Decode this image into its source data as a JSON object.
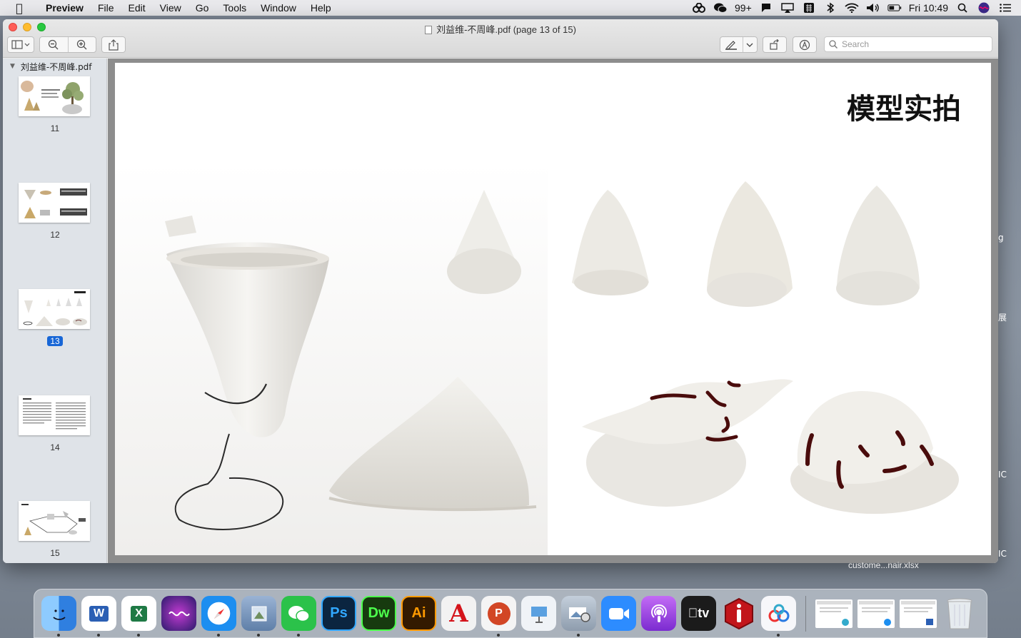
{
  "menubar": {
    "app_name": "Preview",
    "menus": [
      "File",
      "Edit",
      "View",
      "Go",
      "Tools",
      "Window",
      "Help"
    ],
    "wechat_badge": "99+",
    "clock": "Fri 10:49"
  },
  "window": {
    "title": "刘益维-不周峰.pdf (page 13 of 15)",
    "search_placeholder": "Search"
  },
  "sidebar": {
    "file_name": "刘益维-不周峰.pdf",
    "pages": [
      {
        "num": "11"
      },
      {
        "num": "12"
      },
      {
        "num": "13",
        "selected": true
      },
      {
        "num": "14"
      },
      {
        "num": "15"
      }
    ]
  },
  "page": {
    "title": "模型实拍"
  },
  "desktop": {
    "file_label": "custome...nair.xlsx",
    "edge_labels": [
      "g",
      "展",
      "IC",
      "IC"
    ]
  },
  "dock": {
    "apps": [
      {
        "name": "Finder",
        "label": "",
        "color": "#2f8ff0"
      },
      {
        "name": "Word",
        "label": "W",
        "color": "#2b5fb4"
      },
      {
        "name": "Excel",
        "label": "X",
        "color": "#1f7a45"
      },
      {
        "name": "Siri",
        "label": "",
        "color": "#5b3bb5"
      },
      {
        "name": "Safari",
        "label": "",
        "color": "#1c8ef0"
      },
      {
        "name": "Preview",
        "label": "",
        "color": "#6f8fb8"
      },
      {
        "name": "WeChat",
        "label": "",
        "color": "#2bc24a"
      },
      {
        "name": "Photoshop",
        "label": "Ps",
        "color": "#0b2540"
      },
      {
        "name": "Dreamweaver",
        "label": "Dw",
        "color": "#173a0f"
      },
      {
        "name": "Illustrator",
        "label": "Ai",
        "color": "#331a00"
      },
      {
        "name": "Acrobat",
        "label": "A",
        "color": "#e8e8e8"
      },
      {
        "name": "PowerPoint",
        "label": "P",
        "color": "#f4f4f4"
      },
      {
        "name": "Keynote",
        "label": "",
        "color": "#f0f3f7"
      },
      {
        "name": "Image Capture",
        "label": "",
        "color": "#9aa8b8"
      },
      {
        "name": "Zoom",
        "label": "",
        "color": "#2d8cff"
      },
      {
        "name": "Podcasts",
        "label": "",
        "color": "#9a4de0"
      },
      {
        "name": "Apple TV",
        "label": "tv",
        "color": "#1b1b1b"
      },
      {
        "name": "Info",
        "label": "i",
        "color": "#c2161b"
      },
      {
        "name": "Baidu Netdisk",
        "label": "",
        "color": "#f7f7fa"
      }
    ]
  }
}
